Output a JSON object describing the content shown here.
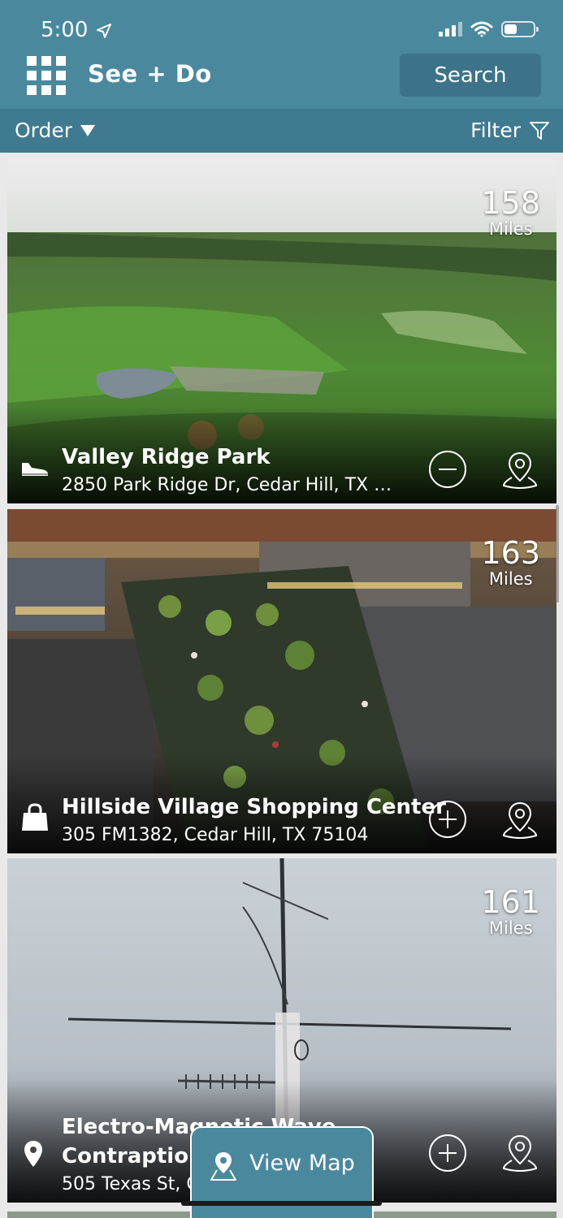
{
  "status_bar": {
    "time": "5:00"
  },
  "header": {
    "title": "See + Do",
    "search_label": "Search"
  },
  "toolbar": {
    "order_label": "Order",
    "filter_label": "Filter"
  },
  "places": [
    {
      "name": "Valley Ridge Park",
      "address": "2850 Park Ridge Dr, Cedar Hill, TX 7...",
      "distance": "158",
      "unit": "Miles",
      "category_icon": "shoe-icon",
      "action_icon": "minus-circle-icon"
    },
    {
      "name": "Hillside Village Shopping Center",
      "address": "305 FM1382, Cedar Hill, TX 75104",
      "distance": "163",
      "unit": "Miles",
      "category_icon": "shopping-bag-icon",
      "action_icon": "plus-circle-icon"
    },
    {
      "name_line1": "Electro-Magnetic Wave",
      "name_line2": "Contraption",
      "address": "505 Texas St, C",
      "distance": "161",
      "unit": "Miles",
      "category_icon": "location-pin-icon",
      "action_icon": "plus-circle-icon"
    }
  ],
  "view_map_label": "View Map",
  "colors": {
    "header": "#4a889e",
    "toolbar": "#3f7a90",
    "search_button": "#3c7388"
  }
}
